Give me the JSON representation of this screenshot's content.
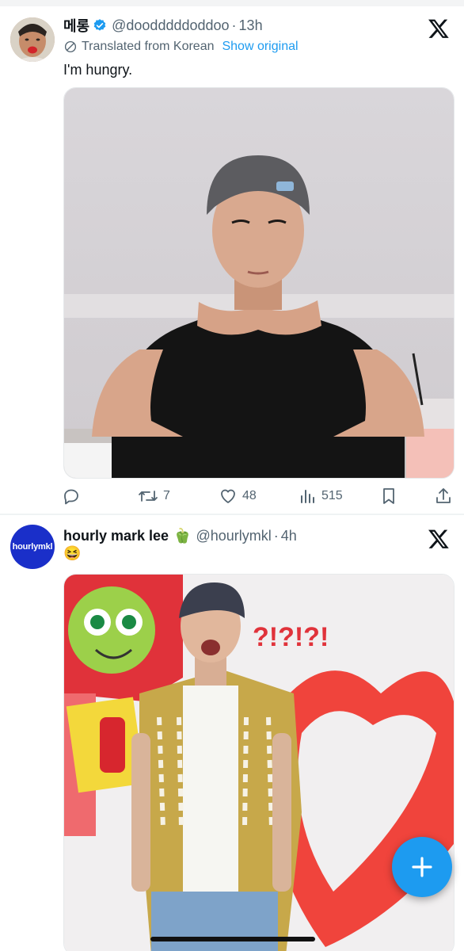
{
  "colors": {
    "accent": "#1d9bf0",
    "secondary_text": "#536471",
    "primary_text": "#0f1419"
  },
  "tweets": [
    {
      "display_name": "메롱",
      "verified": true,
      "handle": "@doodddddoddoo",
      "separator": "·",
      "time": "13h",
      "translated_label": "Translated from Korean",
      "show_original_label": "Show original",
      "text": "I'm hungry.",
      "media_description_icon": "photo-young-man-black-tshirt-backwards-cap",
      "stats": {
        "retweets": "7",
        "likes": "48",
        "views": "515"
      }
    },
    {
      "avatar_text": "hourlymkl",
      "display_name": "hourly mark lee",
      "name_emoji": "🫑",
      "handle": "@hourlymkl",
      "separator": "·",
      "time": "4h",
      "text": "😆",
      "media_sign_text": "?!?!?!"
    }
  ],
  "fab": {
    "icon": "plus-icon"
  }
}
